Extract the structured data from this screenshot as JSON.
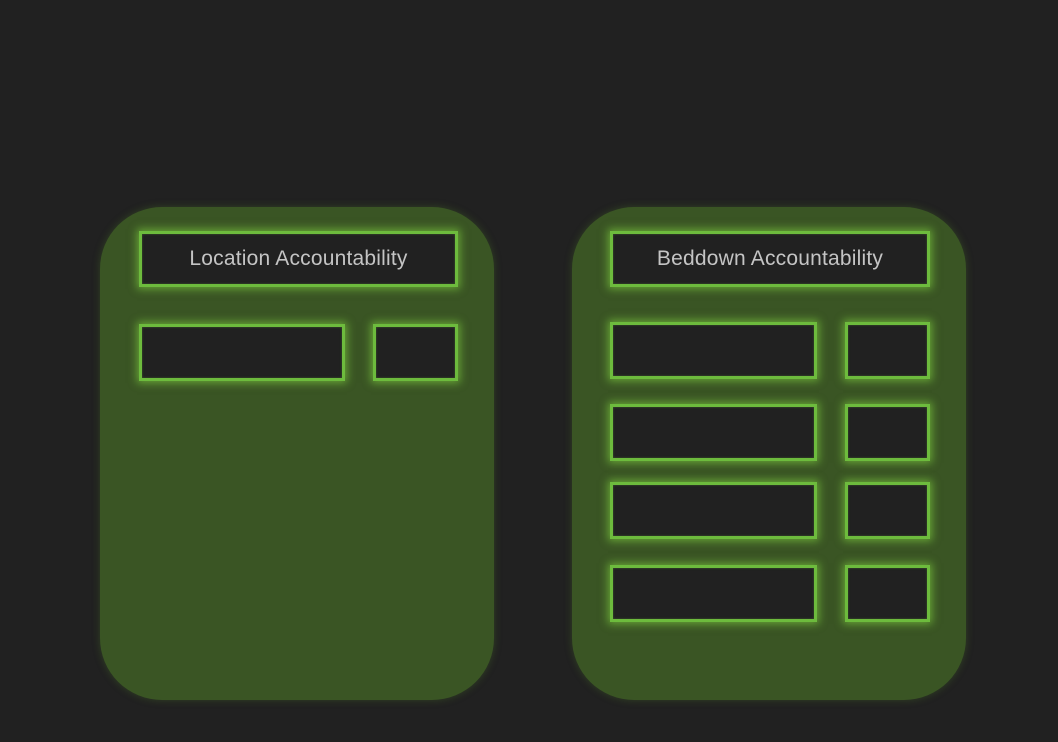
{
  "colors": {
    "background": "#212121",
    "panel": "#3a5524",
    "box_border": "#6dbb3d",
    "title_text": "#c4c4c4"
  },
  "location_panel": {
    "title": "Location Accountability",
    "rows": [
      {
        "name": "",
        "value": ""
      }
    ]
  },
  "beddown_panel": {
    "title": "Beddown Accountability",
    "rows": [
      {
        "name": "",
        "value": ""
      },
      {
        "name": "",
        "value": ""
      },
      {
        "name": "",
        "value": ""
      },
      {
        "name": "",
        "value": ""
      }
    ]
  }
}
